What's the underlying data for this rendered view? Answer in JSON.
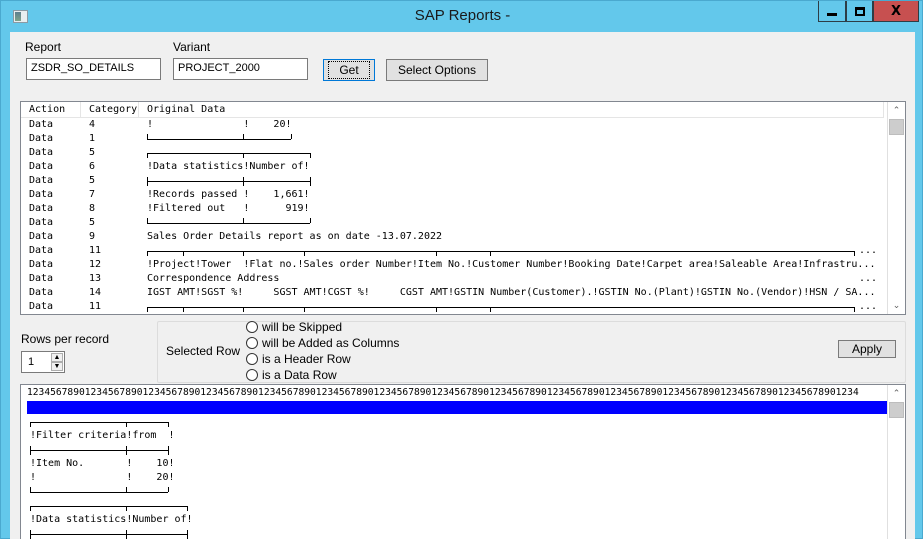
{
  "window": {
    "title": "SAP Reports -",
    "controls": {
      "minimize": "minimize",
      "maximize": "maximize",
      "close": "X"
    }
  },
  "form": {
    "report_label": "Report",
    "report_value": "ZSDR_SO_DETAILS",
    "variant_label": "Variant",
    "variant_value": "PROJECT_2000",
    "get_label": "Get",
    "select_options_label": "Select Options"
  },
  "listview": {
    "columns": [
      "Action",
      "Category",
      "Original Data"
    ],
    "rows": [
      {
        "action": "Data",
        "category": "4",
        "data": "!               !    20!"
      },
      {
        "action": "Data",
        "category": "1",
        "data": ""
      },
      {
        "action": "Data",
        "category": "5",
        "data": ""
      },
      {
        "action": "Data",
        "category": "6",
        "data": "!Data statistics!Number of!"
      },
      {
        "action": "Data",
        "category": "5",
        "data": ""
      },
      {
        "action": "Data",
        "category": "7",
        "data": "!Records passed !    1,661!"
      },
      {
        "action": "Data",
        "category": "8",
        "data": "!Filtered out   !      919!"
      },
      {
        "action": "Data",
        "category": "5",
        "data": ""
      },
      {
        "action": "Data",
        "category": "9",
        "data": "Sales Order Details report as on date -13.07.2022"
      },
      {
        "action": "Data",
        "category": "11",
        "data": "",
        "ellipsis": "..."
      },
      {
        "action": "Data",
        "category": "12",
        "data": "!Project!Tower  !Flat no.!Sales order Number!Item No.!Customer Number!Booking Date!Carpet area!Saleable Area!Infrastru...",
        "ellipsis": ""
      },
      {
        "action": "Data",
        "category": "13",
        "data": "Correspondence Address",
        "ellipsis": "..."
      },
      {
        "action": "Data",
        "category": "14",
        "data": "IGST AMT!SGST %!     SGST AMT!CGST %!     CGST AMT!GSTIN Number(Customer).!GSTIN No.(Plant)!GSTIN No.(Vendor)!HSN / SA...",
        "ellipsis": ""
      },
      {
        "action": "Data",
        "category": "11",
        "data": "",
        "ellipsis": "..."
      }
    ]
  },
  "options": {
    "rows_per_record_label": "Rows per record",
    "rows_per_record_value": "1",
    "selected_row_label": "Selected Row",
    "radios": [
      "will be Skipped",
      "will be Added as Columns",
      "is a Header Row",
      "is a Data Row"
    ],
    "apply_label": "Apply"
  },
  "textview": {
    "ruler": "123456789012345678901234567890123456789012345678901234567890123456789012345678901234567890123456789012345678901234567890123456789012345678901234",
    "lines": [
      "",
      "!Filter criteria!from  !",
      "",
      "!Item No.       !    10!",
      "!               !    20!",
      "",
      "",
      "!Data statistics!Number of!",
      ""
    ]
  },
  "colors": {
    "titlebar": "#63c8eb",
    "close_button": "#c75050",
    "selection": "#0000ff"
  }
}
